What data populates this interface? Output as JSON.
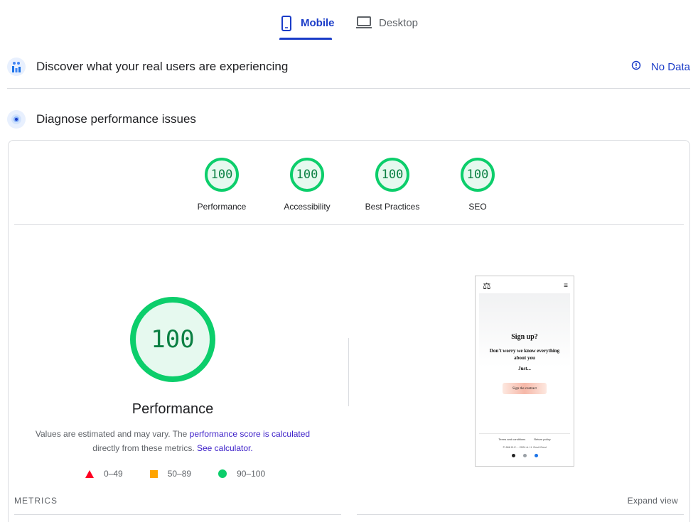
{
  "tabs": [
    {
      "label": "Mobile",
      "icon": "smartphone-icon",
      "active": true
    },
    {
      "label": "Desktop",
      "icon": "laptop-icon",
      "active": false
    }
  ],
  "real_users": {
    "title": "Discover what your real users are experiencing",
    "icon": "crux-users-icon",
    "status_icon": "info-icon",
    "status": "No Data"
  },
  "diagnose": {
    "title": "Diagnose performance issues",
    "icon": "lighthouse-icon"
  },
  "scores": [
    {
      "value": "100",
      "label": "Performance"
    },
    {
      "value": "100",
      "label": "Accessibility"
    },
    {
      "value": "100",
      "label": "Best Practices"
    },
    {
      "value": "100",
      "label": "SEO"
    }
  ],
  "performance": {
    "score": "100",
    "title": "Performance",
    "desc_part1": "Values are estimated and may vary. The ",
    "desc_link1": "performance score is calculated",
    "desc_part2": " directly from these metrics. ",
    "desc_link2": "See calculator."
  },
  "legend": [
    {
      "shape": "triangle",
      "range": "0–49",
      "color": "#ff0022"
    },
    {
      "shape": "square",
      "range": "50–89",
      "color": "#ffa400"
    },
    {
      "shape": "circle",
      "range": "90–100",
      "color": "#0cce6b"
    }
  ],
  "thumbnail": {
    "logo": "⚖",
    "menu": "≡",
    "heading": "Sign up?",
    "subheading": "Don't worry we know everything about you",
    "tagline": "Just...",
    "button": "Sign the contract",
    "footer_links": [
      "Terms and conditions",
      "Return policy"
    ],
    "copyright": "© 666 B.C. - 2024 A. H. Devil Deal"
  },
  "metrics": {
    "label": "METRICS",
    "expand": "Expand view"
  },
  "colors": {
    "accent": "#1a3cc8",
    "pass": "#0cce6b",
    "pass_bg": "#e6f9ef",
    "pass_text": "#0b8043"
  }
}
